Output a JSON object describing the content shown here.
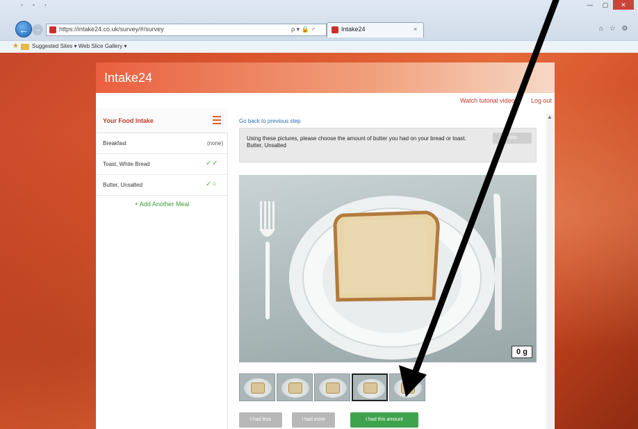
{
  "window": {
    "minimize_glyph": "—",
    "maximize_glyph": "▢",
    "close_glyph": "✕"
  },
  "browser": {
    "back_glyph": "←",
    "forward_glyph": "→",
    "address": "https://intake24.co.uk/survey/#/survey",
    "address_icons": "ρ ▾ 🔒 ♂",
    "tab_title": "Intake24",
    "tab_close": "×",
    "toolbar_icons": "⌂ ☆ ⚙",
    "favorites_text": "Suggested Sites ▾   Web Slice Gallery ▾"
  },
  "app": {
    "title": "Intake24",
    "nav": {
      "watch_tutorial": "Watch tutorial video",
      "logout": "Log out"
    }
  },
  "sidebar": {
    "title": "Your Food Intake",
    "meals": [
      {
        "name": "Breakfast",
        "status": "(none)",
        "check": ""
      },
      {
        "name": "Toast, White Bread",
        "status": "",
        "check": "✓✓"
      },
      {
        "name": "Butter, Unsalted",
        "status": "",
        "check": "✓○"
      }
    ],
    "add_meal": "+ Add Another Meal"
  },
  "main": {
    "go_back": "Go back to previous step",
    "instruction": "Using these pictures, please choose the amount of butter you had on your bread or toast. Butter, Unsalted",
    "instruction_button": "Help",
    "weight_label": "0 g",
    "buttons": {
      "less": "I had less",
      "more": "I had more",
      "done": "I had this amount"
    }
  }
}
